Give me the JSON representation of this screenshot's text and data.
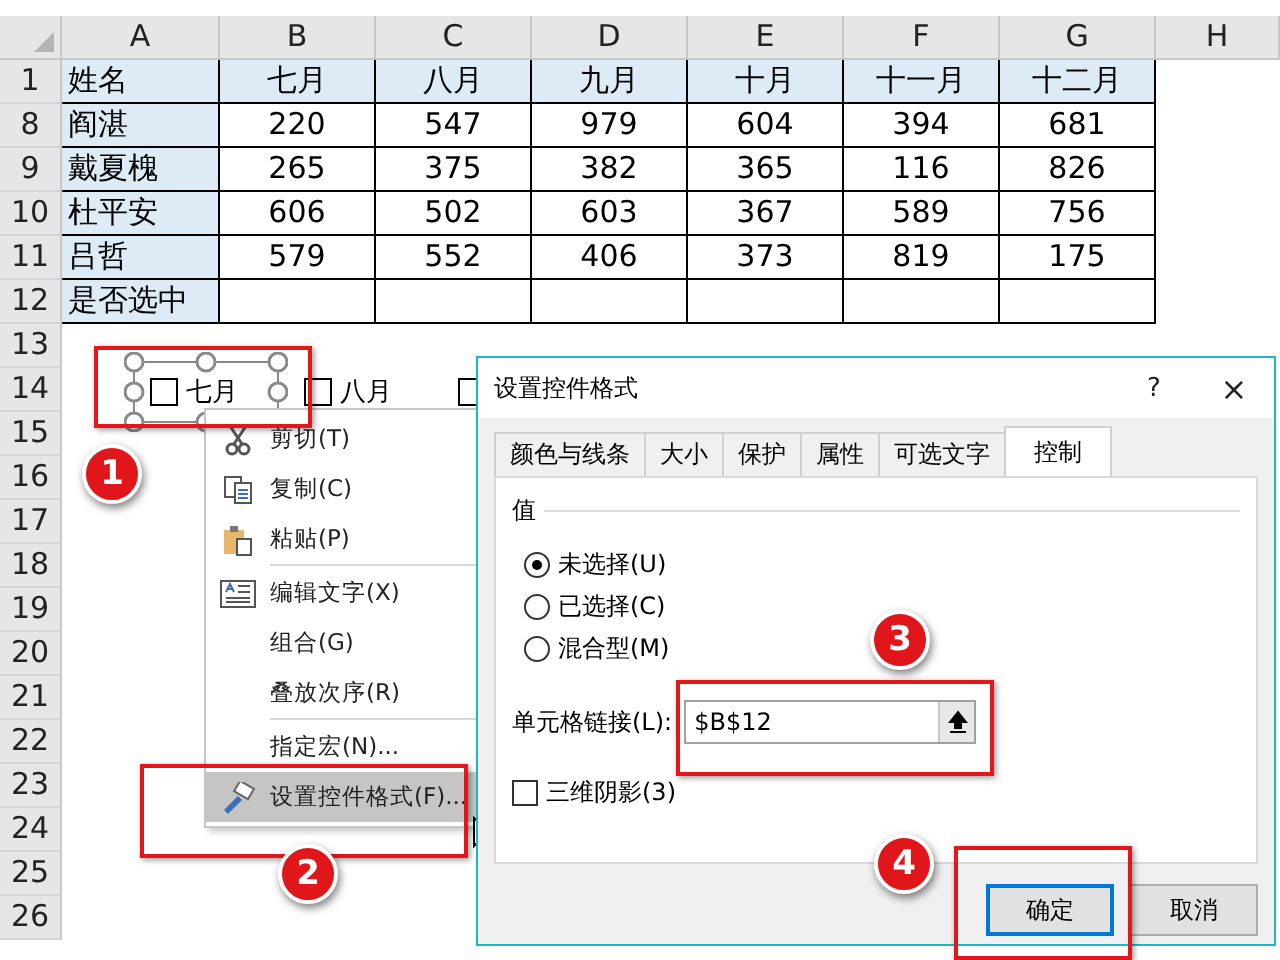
{
  "sheet": {
    "column_headers": [
      "A",
      "B",
      "C",
      "D",
      "E",
      "F",
      "G",
      "H"
    ],
    "rows": [
      {
        "number": "1",
        "kind": "header",
        "cells": [
          "姓名",
          "七月",
          "八月",
          "九月",
          "十月",
          "十一月",
          "十二月"
        ]
      },
      {
        "number": "8",
        "kind": "data",
        "cells": [
          "阎湛",
          "220",
          "547",
          "979",
          "604",
          "394",
          "681"
        ]
      },
      {
        "number": "9",
        "kind": "data",
        "cells": [
          "戴夏槐",
          "265",
          "375",
          "382",
          "365",
          "116",
          "826"
        ]
      },
      {
        "number": "10",
        "kind": "data",
        "cells": [
          "杜平安",
          "606",
          "502",
          "603",
          "367",
          "589",
          "756"
        ]
      },
      {
        "number": "11",
        "kind": "data",
        "cells": [
          "吕哲",
          "579",
          "552",
          "406",
          "373",
          "819",
          "175"
        ]
      },
      {
        "number": "12",
        "kind": "data",
        "cells": [
          "是否选中",
          "",
          "",
          "",
          "",
          "",
          ""
        ]
      }
    ],
    "empty_row_numbers": [
      "13",
      "14",
      "15",
      "16",
      "17",
      "18",
      "19",
      "20",
      "21",
      "22",
      "23",
      "24",
      "25",
      "26"
    ]
  },
  "form_checkboxes": [
    {
      "label": "七月",
      "checked": false,
      "selected": true
    },
    {
      "label": "八月",
      "checked": false,
      "selected": false
    },
    {
      "checked": false,
      "selected": false
    }
  ],
  "context_menu": {
    "items": [
      {
        "label": "剪切(T)",
        "separator_before": false,
        "selected": false
      },
      {
        "label": "复制(C)",
        "separator_before": false,
        "selected": false
      },
      {
        "label": "粘贴(P)",
        "separator_before": false,
        "selected": false
      },
      {
        "label": "编辑文字(X)",
        "separator_before": true,
        "selected": false
      },
      {
        "label": "组合(G)",
        "separator_before": false,
        "selected": false
      },
      {
        "label": "叠放次序(R)",
        "separator_before": false,
        "selected": false
      },
      {
        "label": "指定宏(N)...",
        "separator_before": true,
        "selected": false
      },
      {
        "label": "设置控件格式(F)...",
        "separator_before": false,
        "selected": true
      }
    ]
  },
  "dialog": {
    "title": "设置控件格式",
    "help": "?",
    "close": "×",
    "tabs": [
      {
        "label": "颜色与线条",
        "selected": false
      },
      {
        "label": "大小",
        "selected": false
      },
      {
        "label": "保护",
        "selected": false
      },
      {
        "label": "属性",
        "selected": false
      },
      {
        "label": "可选文字",
        "selected": false
      },
      {
        "label": "控制",
        "selected": true
      }
    ],
    "group": "值",
    "radios": [
      {
        "label": "未选择(U)",
        "selected": true
      },
      {
        "label": "已选择(C)",
        "selected": false
      },
      {
        "label": "混合型(M)",
        "selected": false
      }
    ],
    "cell_link": {
      "label": "单元格链接(L):",
      "value": "$B$12"
    },
    "shading": {
      "label": "三维阴影(3)",
      "checked": false
    },
    "buttons": [
      {
        "label": "确定",
        "focused": true
      },
      {
        "label": "取消",
        "focused": false
      }
    ]
  },
  "annotations": [
    {
      "number": "1"
    },
    {
      "number": "2"
    },
    {
      "number": "3"
    },
    {
      "number": "4"
    }
  ]
}
